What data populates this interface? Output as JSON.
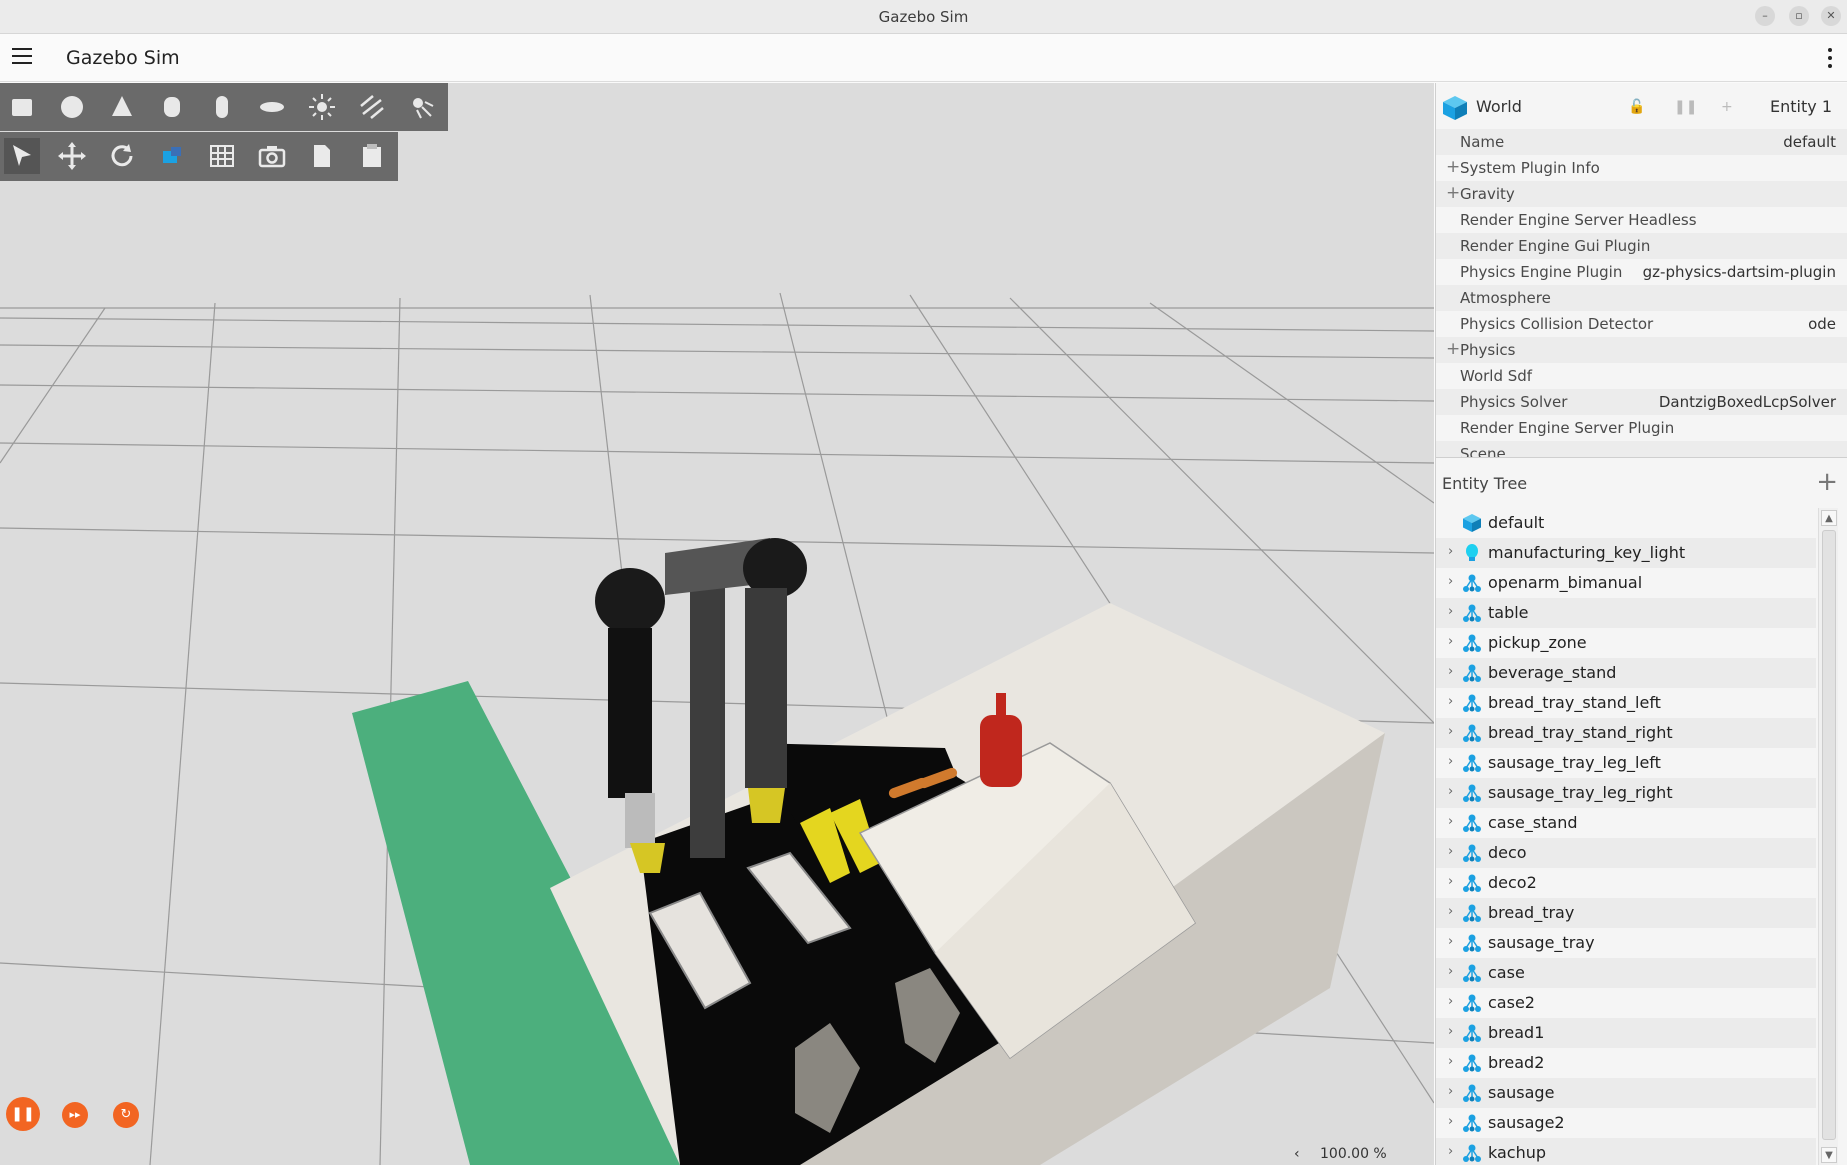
{
  "window": {
    "title": "Gazebo Sim"
  },
  "appbar": {
    "title": "Gazebo Sim"
  },
  "component_inspector": {
    "entity_name": "World",
    "entity_id": "Entity 1",
    "properties": [
      {
        "key": "Name",
        "value": "default",
        "expandable": false
      },
      {
        "key": "System Plugin Info",
        "value": "",
        "expandable": true
      },
      {
        "key": "Gravity",
        "value": "",
        "expandable": true
      },
      {
        "key": "Render Engine Server Headless",
        "value": "",
        "expandable": false
      },
      {
        "key": "Render Engine Gui Plugin",
        "value": "",
        "expandable": false
      },
      {
        "key": "Physics Engine Plugin",
        "value": "gz-physics-dartsim-plugin",
        "expandable": false
      },
      {
        "key": "Atmosphere",
        "value": "",
        "expandable": false
      },
      {
        "key": "Physics Collision Detector",
        "value": "ode",
        "expandable": false
      },
      {
        "key": "Physics",
        "value": "",
        "expandable": true
      },
      {
        "key": "World Sdf",
        "value": "",
        "expandable": false
      },
      {
        "key": "Physics Solver",
        "value": "DantzigBoxedLcpSolver",
        "expandable": false
      },
      {
        "key": "Render Engine Server Plugin",
        "value": "",
        "expandable": false
      },
      {
        "key": "Scene",
        "value": "",
        "expandable": false
      }
    ]
  },
  "entity_tree": {
    "title": "Entity Tree",
    "items": [
      {
        "label": "default",
        "icon": "world-icon",
        "expandable": false
      },
      {
        "label": "manufacturing_key_light",
        "icon": "light-icon",
        "expandable": true
      },
      {
        "label": "openarm_bimanual",
        "icon": "model-icon",
        "expandable": true
      },
      {
        "label": "table",
        "icon": "model-icon",
        "expandable": true
      },
      {
        "label": "pickup_zone",
        "icon": "model-icon",
        "expandable": true
      },
      {
        "label": "beverage_stand",
        "icon": "model-icon",
        "expandable": true
      },
      {
        "label": "bread_tray_stand_left",
        "icon": "model-icon",
        "expandable": true
      },
      {
        "label": "bread_tray_stand_right",
        "icon": "model-icon",
        "expandable": true
      },
      {
        "label": "sausage_tray_leg_left",
        "icon": "model-icon",
        "expandable": true
      },
      {
        "label": "sausage_tray_leg_right",
        "icon": "model-icon",
        "expandable": true
      },
      {
        "label": "case_stand",
        "icon": "model-icon",
        "expandable": true
      },
      {
        "label": "deco",
        "icon": "model-icon",
        "expandable": true
      },
      {
        "label": "deco2",
        "icon": "model-icon",
        "expandable": true
      },
      {
        "label": "bread_tray",
        "icon": "model-icon",
        "expandable": true
      },
      {
        "label": "sausage_tray",
        "icon": "model-icon",
        "expandable": true
      },
      {
        "label": "case",
        "icon": "model-icon",
        "expandable": true
      },
      {
        "label": "case2",
        "icon": "model-icon",
        "expandable": true
      },
      {
        "label": "bread1",
        "icon": "model-icon",
        "expandable": true
      },
      {
        "label": "bread2",
        "icon": "model-icon",
        "expandable": true
      },
      {
        "label": "sausage",
        "icon": "model-icon",
        "expandable": true
      },
      {
        "label": "sausage2",
        "icon": "model-icon",
        "expandable": true
      },
      {
        "label": "kachup",
        "icon": "model-icon",
        "expandable": true
      }
    ]
  },
  "toolbar_shapes": [
    "box-icon",
    "sphere-icon",
    "cone-icon",
    "cylinder-icon",
    "capsule-icon",
    "ellipsoid-icon",
    "point-light-icon",
    "directional-light-icon",
    "spot-light-icon"
  ],
  "toolbar_tools": [
    "select-icon",
    "translate-icon",
    "rotate-icon",
    "scale-icon",
    "grid-snap-icon",
    "screenshot-icon",
    "copy-icon",
    "paste-icon"
  ],
  "sim_controls": {
    "zoom": "100.00 %"
  },
  "colors": {
    "accent": "#f26522",
    "world_cube": "#1ba1e2",
    "scene_bg": "#dcdcdc",
    "ground_strip": "#4caf7d"
  }
}
